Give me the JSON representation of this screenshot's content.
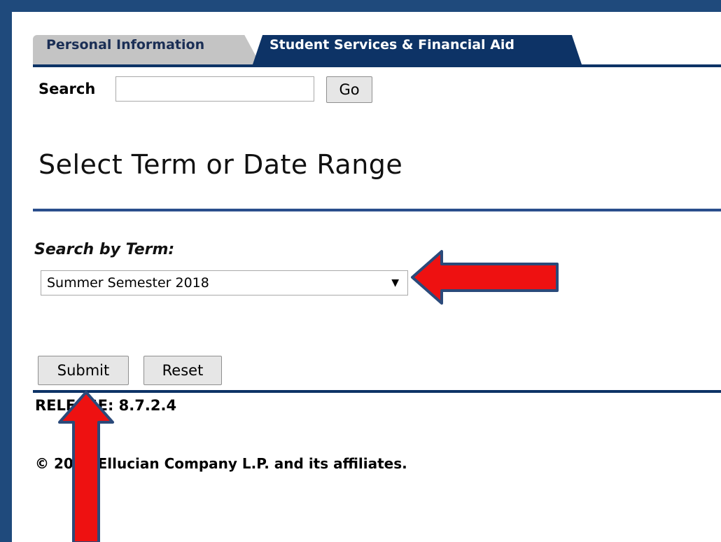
{
  "tabs": [
    {
      "label": "Personal Information",
      "active": false
    },
    {
      "label": "Student Services & Financial Aid",
      "active": true
    }
  ],
  "search": {
    "label": "Search",
    "value": "",
    "go_label": "Go"
  },
  "page_title": "Select Term or Date Range",
  "term": {
    "label": "Search by Term:",
    "selected": "Summer Semester 2018",
    "caret": "▼"
  },
  "actions": {
    "submit_label": "Submit",
    "reset_label": "Reset"
  },
  "footer": {
    "release": "RELEASE: 8.7.2.4",
    "copyright": "© 2018 Ellucian Company L.P. and its affiliates."
  },
  "colors": {
    "frame": "#1f4a7c",
    "tab_active": "#0d3366",
    "tab_inactive": "#c4c4c4",
    "rule": "#2a4e8c",
    "annotation_arrow": "#ee1111",
    "annotation_outline": "#2b4a7a"
  }
}
